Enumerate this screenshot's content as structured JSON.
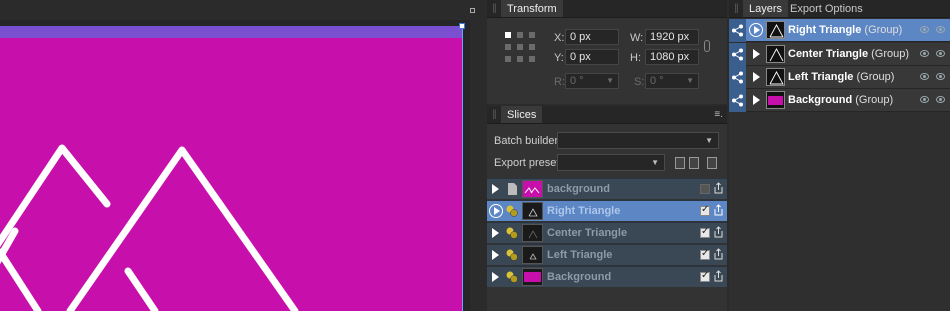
{
  "transform": {
    "tab": "Transform",
    "x_label": "X:",
    "x_value": "0 px",
    "y_label": "Y:",
    "y_value": "0 px",
    "w_label": "W:",
    "w_value": "1920 px",
    "h_label": "H:",
    "h_value": "1080 px",
    "r_label": "R:",
    "r_value": "0 °",
    "s_label": "S:",
    "s_value": "0 °"
  },
  "slices": {
    "tab": "Slices",
    "batch_builder_label": "Batch builder:",
    "export_preset_label": "Export preset:",
    "items": [
      {
        "name": "background",
        "checked": false
      },
      {
        "name": "Right Triangle",
        "checked": true
      },
      {
        "name": "Center Triangle",
        "checked": true
      },
      {
        "name": "Left Triangle",
        "checked": true
      },
      {
        "name": "Background",
        "checked": true
      }
    ]
  },
  "layers": {
    "tab_layers": "Layers",
    "tab_export": "Export Options",
    "items": [
      {
        "name": "Right Triangle",
        "suffix": "(Group)"
      },
      {
        "name": "Center Triangle",
        "suffix": "(Group)"
      },
      {
        "name": "Left Triangle",
        "suffix": "(Group)"
      },
      {
        "name": "Background",
        "suffix": "(Group)"
      }
    ]
  },
  "colors": {
    "canvas_fill": "#c70fab",
    "selection_accent": "#5c87c4",
    "slice_row": "#3a4754"
  }
}
